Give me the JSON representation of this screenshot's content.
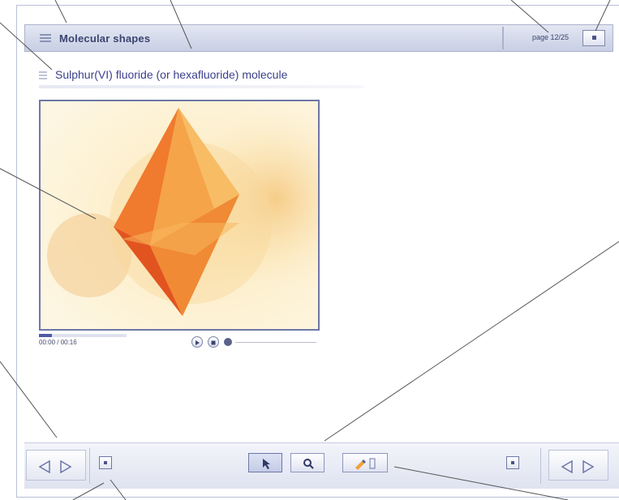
{
  "app": {
    "title": "Molecular shapes",
    "page_counter": "page 12/25"
  },
  "page": {
    "heading": "Sulphur(VI) fluoride (or hexafluoride) molecule"
  },
  "player": {
    "time": "00:00 / 00:16",
    "progress": 0.15
  },
  "toolbar": {
    "tools": [
      {
        "name": "select",
        "icon": "pointer-icon"
      },
      {
        "name": "zoom",
        "icon": "magnifier-icon"
      },
      {
        "name": "annotate",
        "icon": "pencil-icon"
      }
    ]
  },
  "colors": {
    "accent": "#3b3f8c",
    "frame": "#6d77a8",
    "molecule": "#e8662a",
    "background_glow": "#f6d08a"
  }
}
